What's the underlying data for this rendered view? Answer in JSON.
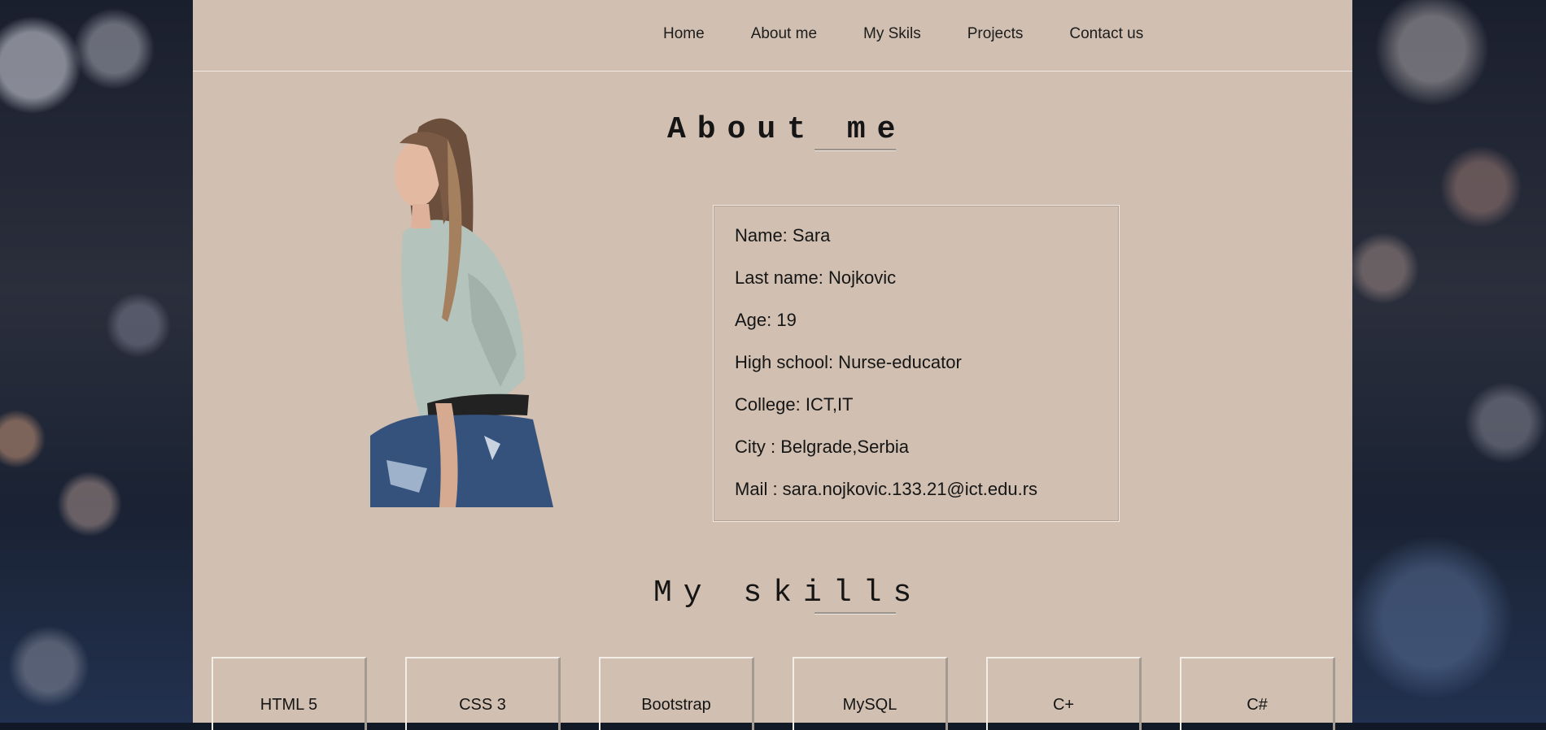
{
  "nav": {
    "items": [
      "Home",
      "About me",
      "My Skils",
      "Projects",
      "Contact us"
    ]
  },
  "about": {
    "title": "About me",
    "info": [
      "Name: Sara",
      "Last name: Nojkovic",
      "Age: 19",
      "High school: Nurse-educator",
      "College: ICT,IT",
      "City : Belgrade,Serbia",
      "Mail : sara.nojkovic.133.21@ict.edu.rs"
    ]
  },
  "skills": {
    "title": "My skills",
    "items": [
      "HTML 5",
      "CSS 3",
      "Bootstrap",
      "MySQL",
      "C+",
      "C#"
    ]
  },
  "colors": {
    "page_bg": "#d1c0b1",
    "text": "#151515",
    "line_light": "#f1e9e2"
  }
}
